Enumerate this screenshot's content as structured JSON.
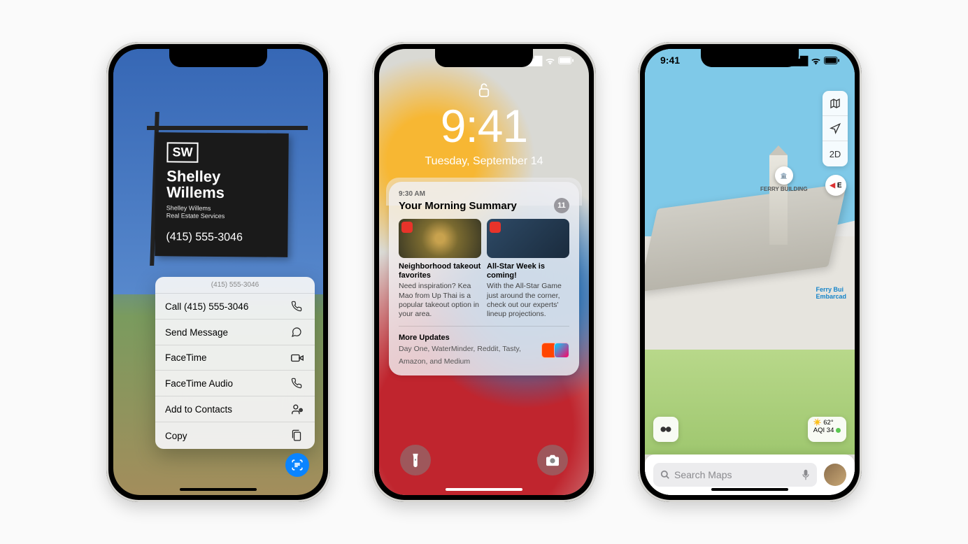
{
  "phone1": {
    "status_time": "",
    "sign": {
      "logo": "SW",
      "name_line1": "Shelley",
      "name_line2": "Willems",
      "sub_line1": "Shelley Willems",
      "sub_line2": "Real Estate Services",
      "phone": "(415) 555-3046"
    },
    "context_menu": {
      "header": "(415) 555-3046",
      "items": [
        {
          "label": "Call (415) 555-3046",
          "icon": "phone-icon"
        },
        {
          "label": "Send Message",
          "icon": "message-icon"
        },
        {
          "label": "FaceTime",
          "icon": "facetime-video-icon"
        },
        {
          "label": "FaceTime Audio",
          "icon": "phone-icon"
        },
        {
          "label": "Add to Contacts",
          "icon": "add-contact-icon"
        },
        {
          "label": "Copy",
          "icon": "copy-icon"
        }
      ]
    }
  },
  "phone2": {
    "time": "9:41",
    "date": "Tuesday, September 14",
    "summary": {
      "time": "9:30 AM",
      "title": "Your Morning Summary",
      "badge": "11",
      "cards": [
        {
          "headline": "Neighborhood takeout favorites",
          "body": "Need inspiration? Kea Mao from Up Thai is a popular takeout option in your area."
        },
        {
          "headline": "All-Star Week is coming!",
          "body": "With the All-Star Game just around the corner, check out our experts' lineup projections."
        }
      ],
      "more_title": "More Updates",
      "more_body": "Day One, WaterMinder, Reddit, Tasty, Amazon, and Medium"
    }
  },
  "phone3": {
    "status_time": "9:41",
    "controls": {
      "view2d": "2D"
    },
    "compass": "E",
    "poi_label": "FERRY BUILDING",
    "ferry_label_line1": "Ferry Bui",
    "ferry_label_line2": "Embarcad",
    "weather": {
      "temp": "62°",
      "aqi_label": "AQI 34"
    },
    "search_placeholder": "Search Maps"
  }
}
